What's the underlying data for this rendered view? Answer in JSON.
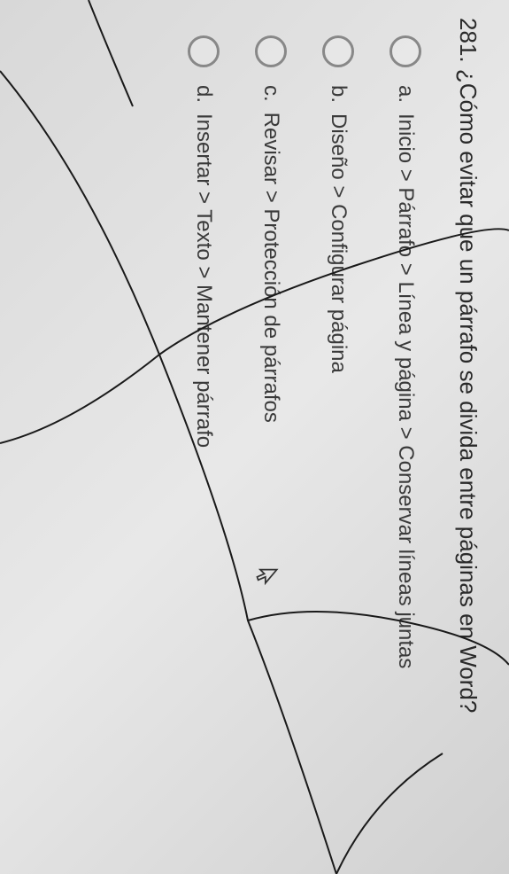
{
  "question": {
    "number": "281.",
    "text": "¿Cómo evitar que un párrafo se divida entre páginas en Word?"
  },
  "options": [
    {
      "label": "a.",
      "text": "Inicio > Párrafo > Línea y página > Conservar líneas juntas"
    },
    {
      "label": "b.",
      "text": "Diseño > Configurar página"
    },
    {
      "label": "c.",
      "text": "Revisar > Protección de párrafos"
    },
    {
      "label": "d.",
      "text": "Insertar > Texto > Mantener párrafo"
    }
  ]
}
